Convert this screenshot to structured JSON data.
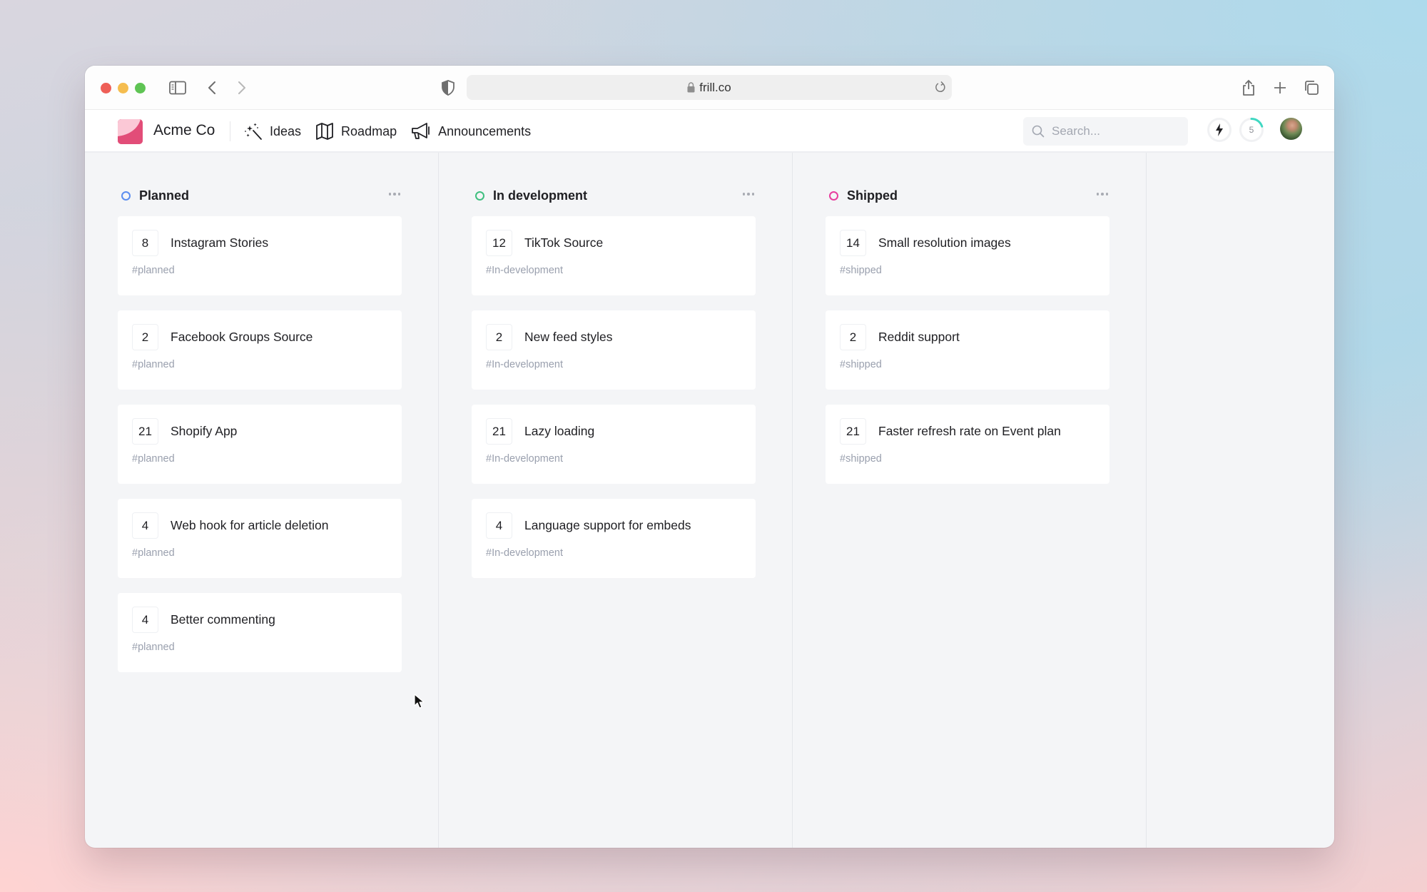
{
  "browser": {
    "url": "frill.co",
    "icons": {
      "sidebar": "sidebar-toggle-icon",
      "back": "chevron-left-icon",
      "forward": "chevron-right-icon",
      "privacy": "shield-icon",
      "lock": "lock-icon",
      "reload": "reload-icon",
      "share": "share-icon",
      "new_tab": "plus-icon",
      "tabs": "tabs-overview-icon"
    }
  },
  "header": {
    "brand": "Acme Co",
    "nav": [
      {
        "label": "Ideas",
        "icon": "magic-wand-icon"
      },
      {
        "label": "Roadmap",
        "icon": "map-icon"
      },
      {
        "label": "Announcements",
        "icon": "megaphone-icon"
      }
    ],
    "search": {
      "placeholder": "Search...",
      "value": ""
    },
    "progress_count": "5",
    "progress_fraction": 0.2,
    "colors": {
      "brand": "#e24d78",
      "brand_light": "#fbc8d6",
      "progress": "#3fd8c2"
    }
  },
  "board": {
    "columns": [
      {
        "title": "Planned",
        "status_color": "#5b8def",
        "cards": [
          {
            "votes": "8",
            "title": "Instagram Stories",
            "tag": "#planned"
          },
          {
            "votes": "2",
            "title": "Facebook Groups Source",
            "tag": "#planned"
          },
          {
            "votes": "21",
            "title": "Shopify App",
            "tag": "#planned"
          },
          {
            "votes": "4",
            "title": "Web hook for article deletion",
            "tag": "#planned"
          },
          {
            "votes": "4",
            "title": "Better commenting",
            "tag": "#planned"
          }
        ]
      },
      {
        "title": "In development",
        "status_color": "#3fbf7f",
        "cards": [
          {
            "votes": "12",
            "title": "TikTok Source",
            "tag": "#In-development"
          },
          {
            "votes": "2",
            "title": "New feed styles",
            "tag": "#In-development"
          },
          {
            "votes": "21",
            "title": "Lazy loading",
            "tag": "#In-development"
          },
          {
            "votes": "4",
            "title": "Language support for embeds",
            "tag": "#In-development"
          }
        ]
      },
      {
        "title": "Shipped",
        "status_color": "#e83e9e",
        "cards": [
          {
            "votes": "14",
            "title": "Small resolution images",
            "tag": "#shipped"
          },
          {
            "votes": "2",
            "title": "Reddit support",
            "tag": "#shipped"
          },
          {
            "votes": "21",
            "title": "Faster refresh rate on Event plan",
            "tag": "#shipped"
          }
        ]
      }
    ]
  }
}
